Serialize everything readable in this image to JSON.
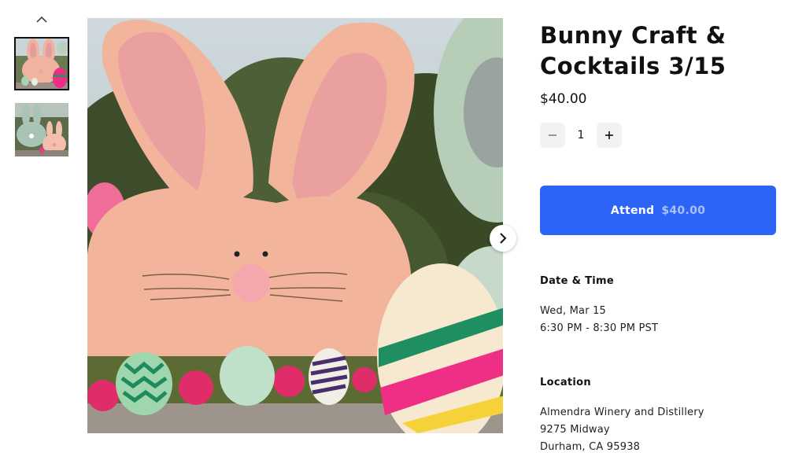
{
  "event": {
    "title": "Bunny Craft & Cocktails 3/15",
    "price": "$40.00"
  },
  "quantity": {
    "value": "1"
  },
  "attend_button": {
    "label": "Attend",
    "price": "$40.00",
    "color": "#2d64f8"
  },
  "date_time": {
    "label": "Date & Time",
    "date": "Wed, Mar 15",
    "time": "6:30 PM - 8:30 PM PST"
  },
  "location": {
    "label": "Location",
    "venue": "Almendra Winery and Distillery",
    "street": "9275 Midway",
    "city": "Durham, CA 95938"
  },
  "gallery": {
    "thumbnails": [
      {
        "icon": "pink-bunny-thumbnail",
        "selected": true
      },
      {
        "icon": "bunny-pair-thumbnail",
        "selected": false
      }
    ],
    "main_image": "pink-bunny-craft-photo"
  },
  "icons": {
    "gallery_up": "chevron-up-icon",
    "gallery_next": "chevron-right-icon",
    "qty_decrease": "minus-icon",
    "qty_increase": "plus-icon"
  }
}
